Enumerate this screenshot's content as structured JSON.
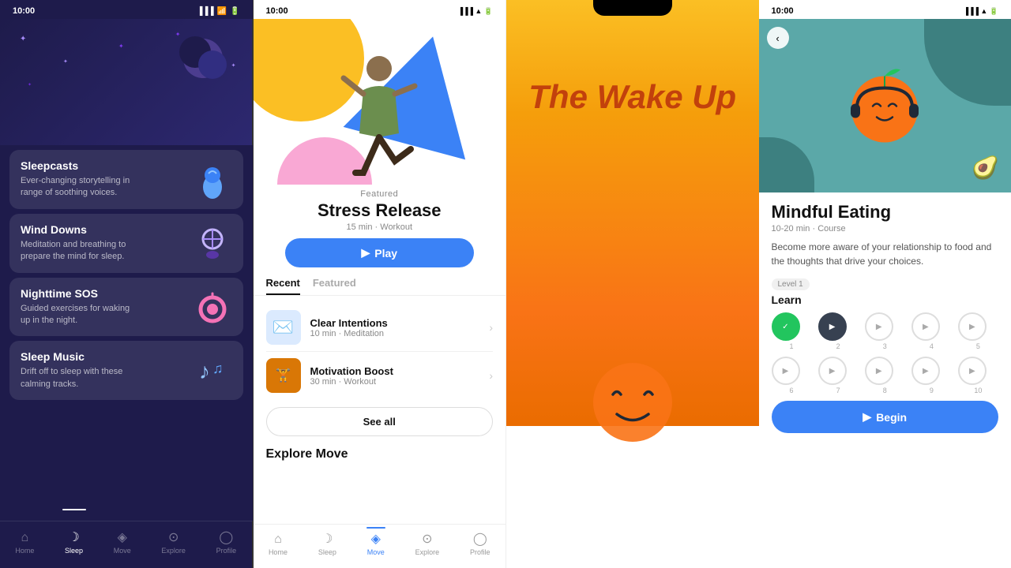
{
  "phone1": {
    "status_time": "10:00",
    "nav": {
      "items": [
        {
          "label": "Home",
          "icon": "⌂",
          "active": false
        },
        {
          "label": "Sleep",
          "icon": "☽",
          "active": true
        },
        {
          "label": "Move",
          "icon": "♦",
          "active": false
        },
        {
          "label": "Explore",
          "icon": "◎",
          "active": false
        },
        {
          "label": "Profile",
          "icon": "○",
          "active": false
        }
      ]
    },
    "cards": [
      {
        "title": "Sleepcasts",
        "description": "Ever-changing storytelling in range of soothing voices.",
        "icon": "💧"
      },
      {
        "title": "Wind Downs",
        "description": "Meditation and breathing to prepare the mind for sleep.",
        "icon": "💡"
      },
      {
        "title": "Nighttime SOS",
        "description": "Guided exercises for waking up in the night.",
        "icon": "🌙"
      },
      {
        "title": "Sleep Music",
        "description": "Drift off to sleep with these calming tracks.",
        "icon": "🎵"
      }
    ]
  },
  "phone2": {
    "status_time": "10:00",
    "featured_label": "Featured",
    "hero_title": "Stress Release",
    "hero_meta": "15 min · Workout",
    "play_button": "Play",
    "tabs": [
      {
        "label": "Recent",
        "active": true
      },
      {
        "label": "Featured",
        "active": false
      }
    ],
    "recent_items": [
      {
        "title": "Clear Intentions",
        "meta": "10 min · Meditation",
        "icon": "✉️",
        "bg": "blue"
      },
      {
        "title": "Motivation Boost",
        "meta": "30 min · Workout",
        "icon": "🏋️",
        "bg": "brown"
      }
    ],
    "see_all_label": "See all",
    "explore_title": "Explore Move",
    "nav": {
      "items": [
        {
          "label": "Home",
          "icon": "⌂",
          "active": false
        },
        {
          "label": "Sleep",
          "icon": "☽",
          "active": false
        },
        {
          "label": "Move",
          "icon": "♦",
          "active": true
        },
        {
          "label": "Explore",
          "icon": "◎",
          "active": false
        },
        {
          "label": "Profile",
          "icon": "○",
          "active": false
        }
      ]
    }
  },
  "phone3": {
    "title_line1": "The Wake Up"
  },
  "phone4": {
    "status_time": "10:00",
    "course_title": "Mindful Eating",
    "course_meta": "10-20 min · Course",
    "course_desc": "Become more aware of your relationship to food and the thoughts that drive your choices.",
    "level_label": "Level 1",
    "learn_label": "Learn",
    "lessons": [
      {
        "num": "1",
        "state": "completed"
      },
      {
        "num": "2",
        "state": "current"
      },
      {
        "num": "3",
        "state": "locked"
      },
      {
        "num": "4",
        "state": "locked"
      },
      {
        "num": "5",
        "state": "locked"
      },
      {
        "num": "6",
        "state": "locked"
      },
      {
        "num": "7",
        "state": "locked"
      },
      {
        "num": "8",
        "state": "locked"
      },
      {
        "num": "9",
        "state": "locked"
      },
      {
        "num": "10",
        "state": "locked"
      }
    ],
    "begin_label": "Begin"
  }
}
